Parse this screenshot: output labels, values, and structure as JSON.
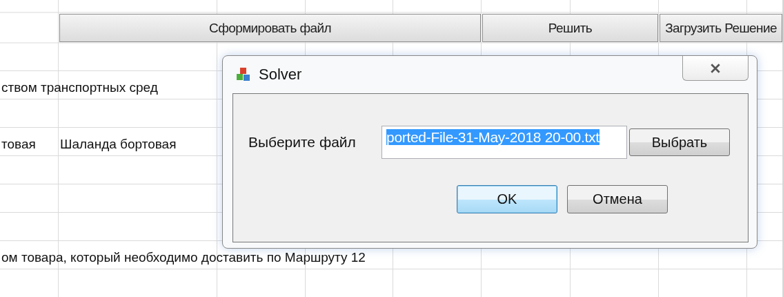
{
  "sheet": {
    "buttons": [
      {
        "label": "Сформировать файл"
      },
      {
        "label": "Решить"
      },
      {
        "label": "Загрузить Решение"
      }
    ],
    "rows": [
      {
        "kind": "blank"
      },
      {
        "kind": "text",
        "cells": [
          "ством транспортных сред"
        ]
      },
      {
        "kind": "blank"
      },
      {
        "kind": "text",
        "cells": [
          "товая",
          "Шаланда бортовая"
        ]
      },
      {
        "kind": "blank"
      },
      {
        "kind": "blank"
      },
      {
        "kind": "blank"
      },
      {
        "kind": "text",
        "cells": [
          "ом товара, который необходимо доставить по Маршруту 12"
        ]
      },
      {
        "kind": "blank"
      }
    ]
  },
  "dialog": {
    "title": "Solver",
    "label": "Выберите файл",
    "file_field": {
      "value": "ported-File-31-May-2018 20-00.txt",
      "text_selected": true
    },
    "browse_button": "Выбрать",
    "buttons": [
      {
        "label": "OK",
        "focused": true
      },
      {
        "label": "Отмена",
        "focused": false
      }
    ]
  }
}
